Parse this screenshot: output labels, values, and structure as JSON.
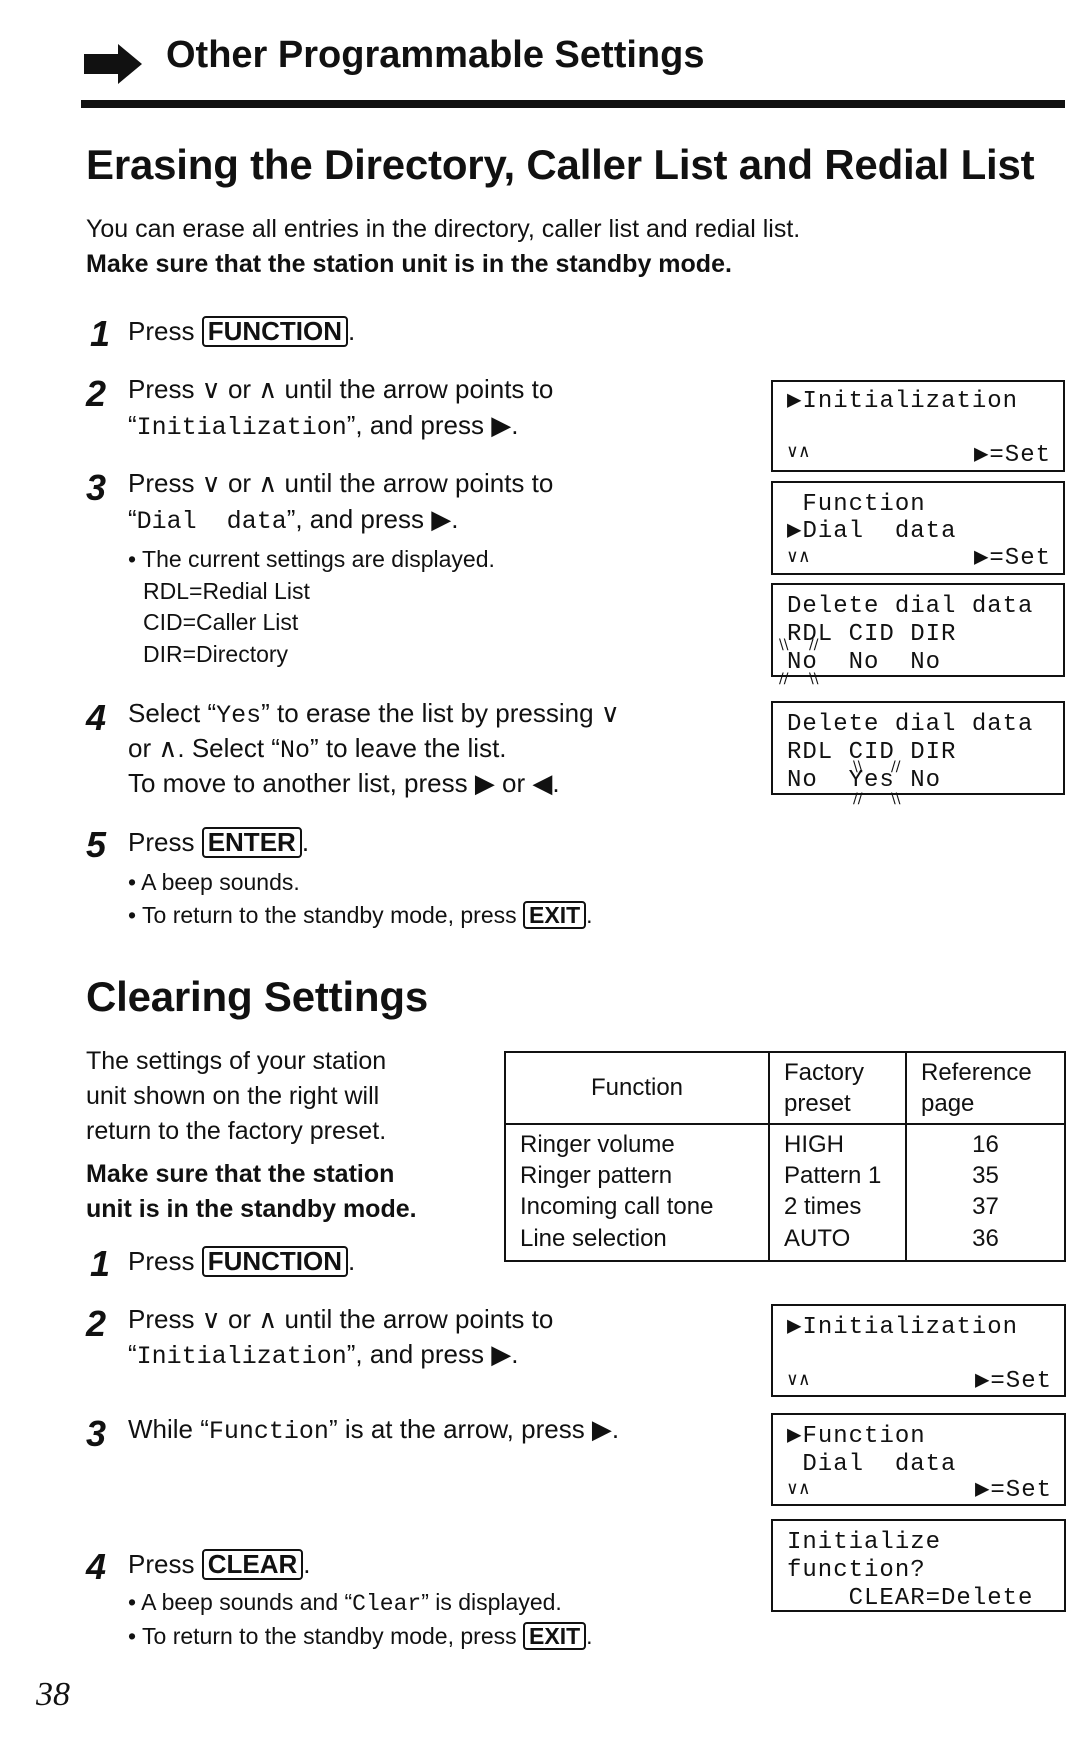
{
  "header": {
    "icon": "right-arrow-icon",
    "title": "Other Programmable Settings"
  },
  "section1": {
    "title": "Erasing the Directory, Caller List and Redial List",
    "intro": "You can erase all entries in the directory, caller list and redial list.",
    "note": "Make sure that the station unit is in the standby mode.",
    "steps": [
      {
        "num": "1",
        "pre": "Press ",
        "key": "FUNCTION",
        "post": "."
      },
      {
        "num": "2",
        "line1": "Press ∨ or ∧ until the arrow points to",
        "line2_quote_open": "“",
        "line2_mono": "Initialization",
        "line2_rest": "”, and press ▶."
      },
      {
        "num": "3",
        "line1": "Press ∨ or ∧ until the arrow points to",
        "line2_quote_open": "“",
        "line2_mono": "Dial  data",
        "line2_rest": "”, and press ▶.",
        "bullets": [
          "• The current settings are displayed.",
          "RDL=Redial List",
          "CID=Caller List",
          "DIR=Directory"
        ]
      },
      {
        "num": "4",
        "line1_pre": "Select “",
        "line1_mono": "Yes",
        "line1_post": "” to erase the list by pressing ∨",
        "line2_pre": "or ∧. Select “",
        "line2_mono": "No",
        "line2_post": "” to leave the list.",
        "line3": "To move to another list, press ▶ or ◀."
      },
      {
        "num": "5",
        "pre": "Press ",
        "key": "ENTER",
        "post": ".",
        "bullets": [
          "• A beep sounds.",
          "• To return to the standby mode, press "
        ],
        "bullet_key": "EXIT",
        "bullet_post": "."
      }
    ],
    "displays": [
      {
        "lines": [
          "▶Initialization",
          "",
          "∨∧"
        ],
        "right": "▶=Set"
      },
      {
        "lines": [
          " Function",
          "▶Dial  data",
          "∨∧"
        ],
        "right": "▶=Set"
      },
      {
        "lines": [
          "Delete dial data",
          "RDL CID DIR",
          "No  No  No"
        ],
        "blinking": "RDL: No"
      },
      {
        "lines": [
          "Delete dial data",
          "RDL CID DIR",
          "No  Yes No"
        ],
        "blinking": "CID: Yes"
      }
    ]
  },
  "section2": {
    "title": "Clearing Settings",
    "para": [
      "The settings of your station",
      "unit shown on the right will",
      "return to the factory preset."
    ],
    "note": [
      "Make sure that the station",
      "unit is in the standby mode."
    ],
    "table": {
      "headers": [
        "Function",
        "Factory\npreset",
        "Reference\npage"
      ],
      "header_lines": [
        [
          "Function"
        ],
        [
          "Factory",
          "preset"
        ],
        [
          "Reference",
          "page"
        ]
      ],
      "rows": [
        {
          "function": "Ringer volume",
          "preset": "HIGH",
          "page": "16"
        },
        {
          "function": "Ringer pattern",
          "preset": "Pattern 1",
          "page": "35"
        },
        {
          "function": "Incoming call tone",
          "preset": "2 times",
          "page": "37"
        },
        {
          "function": "Line selection",
          "preset": "AUTO",
          "page": "36"
        }
      ]
    },
    "steps": [
      {
        "num": "1",
        "pre": "Press ",
        "key": "FUNCTION",
        "post": "."
      },
      {
        "num": "2",
        "line1": "Press ∨ or ∧ until the arrow points to",
        "line2_quote_open": "“",
        "line2_mono": "Initialization",
        "line2_rest": "”, and press ▶."
      },
      {
        "num": "3",
        "pre": "While “",
        "mono": "Function",
        "post": "” is at the arrow, press ▶."
      },
      {
        "num": "4",
        "pre": "Press ",
        "key": "CLEAR",
        "post": ".",
        "bullet1_pre": "• A beep sounds and “",
        "bullet1_mono": "Clear",
        "bullet1_post": "” is displayed.",
        "bullet2_pre": "• To return to the standby mode, press ",
        "bullet2_key": "EXIT",
        "bullet2_post": "."
      }
    ],
    "displays": [
      {
        "lines": [
          "▶Initialization",
          "",
          "∨∧"
        ],
        "right": "▶=Set"
      },
      {
        "lines": [
          "▶Function",
          " Dial  data",
          "∨∧"
        ],
        "right": "▶=Set"
      },
      {
        "lines": [
          "Initialize",
          "function?",
          "    CLEAR=Delete"
        ]
      }
    ]
  },
  "footer": {
    "page_number": "38"
  }
}
